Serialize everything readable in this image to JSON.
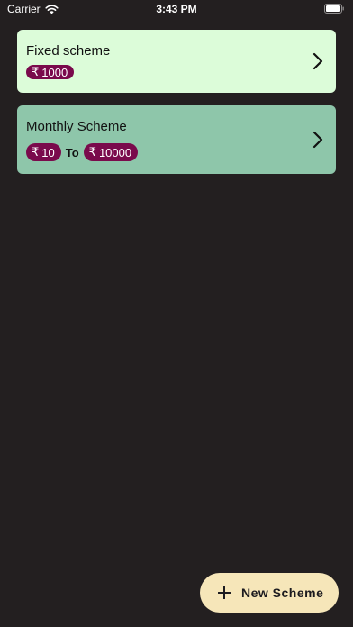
{
  "status_bar": {
    "carrier": "Carrier",
    "time": "3:43 PM",
    "icons": [
      "wifi-icon",
      "battery-icon"
    ]
  },
  "schemes": [
    {
      "title": "Fixed scheme",
      "currency_symbol": "₹",
      "amount": "1000",
      "background": "#dcfcd9"
    },
    {
      "title": "Monthly Scheme",
      "currency_symbol": "₹",
      "min_amount": "10",
      "separator": "To",
      "max_amount": "10000",
      "background": "#8ec6aa"
    }
  ],
  "fab": {
    "label": "New Scheme",
    "icon": "plus-icon"
  },
  "colors": {
    "page_background": "#231f20",
    "pill": "#7a0a4c",
    "fab": "#f6e6b9"
  }
}
